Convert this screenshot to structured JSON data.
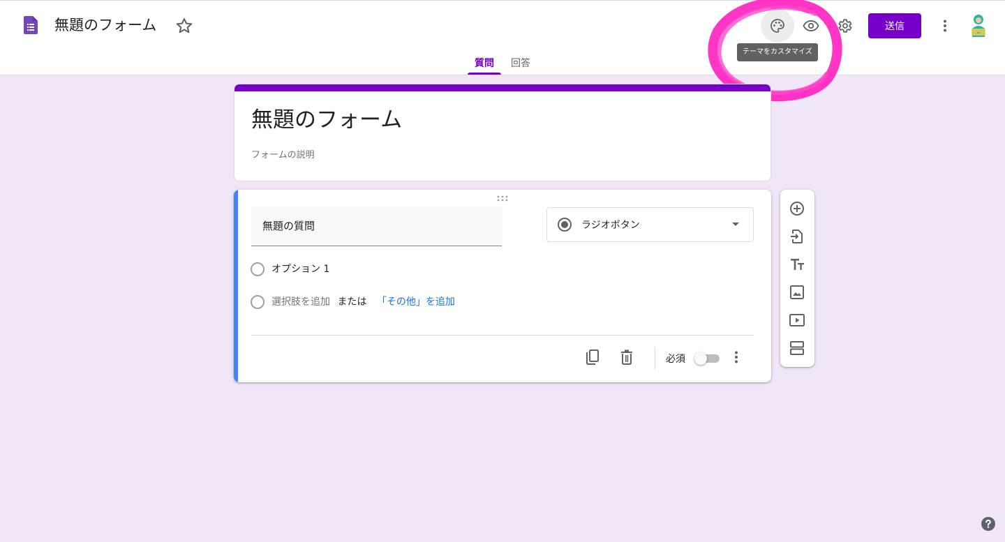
{
  "header": {
    "doc_title": "無題のフォーム",
    "send_label": "送信",
    "tooltip": "テーマをカスタマイズ",
    "tabs": [
      {
        "label": "質問",
        "active": true
      },
      {
        "label": "回答",
        "active": false
      }
    ]
  },
  "form": {
    "title": "無題のフォーム",
    "description_placeholder": "フォームの説明"
  },
  "question": {
    "title": "無題の質問",
    "type_label": "ラジオボタン",
    "options": [
      "オプション 1"
    ],
    "add_choice": "選択肢を追加",
    "or": "または",
    "add_other": "「その他」を追加",
    "required_label": "必須",
    "required": false
  },
  "icons": {
    "header": [
      "forms-logo-icon",
      "star-icon",
      "palette-icon",
      "eye-icon",
      "gear-icon",
      "more-vert-icon",
      "avatar"
    ],
    "side_toolbar": [
      "add-question-icon",
      "import-questions-icon",
      "add-title-icon",
      "add-image-icon",
      "add-video-icon",
      "add-section-icon"
    ],
    "footer": [
      "duplicate-icon",
      "delete-icon",
      "more-vert-icon"
    ]
  },
  "colors": {
    "accent": "#7600c9",
    "background": "#f0e6f8",
    "question_highlight": "#4285f4",
    "link": "#1a73e8",
    "annotation": "#ff1fbf"
  }
}
